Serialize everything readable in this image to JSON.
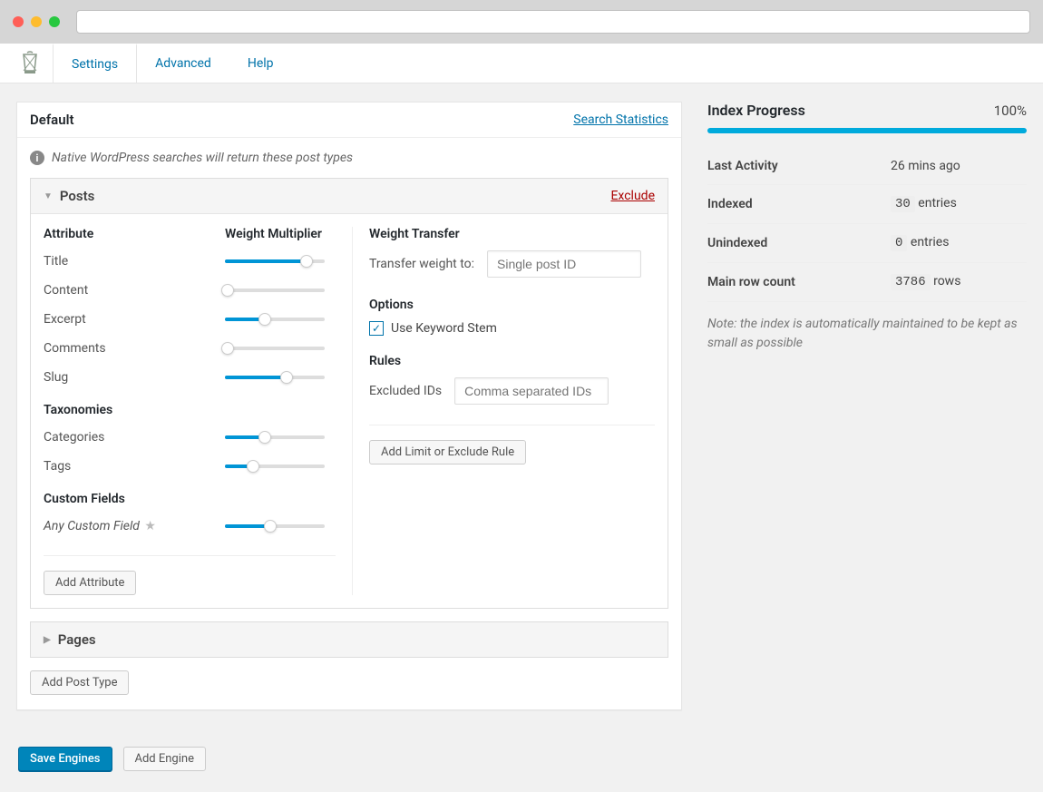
{
  "tabs": {
    "settings": "Settings",
    "advanced": "Advanced",
    "help": "Help"
  },
  "panel": {
    "title": "Default",
    "stats_link": "Search Statistics",
    "note": "Native WordPress searches will return these post types"
  },
  "posts": {
    "title": "Posts",
    "exclude": "Exclude",
    "attribute_hdr": "Attribute",
    "weight_hdr": "Weight Multiplier",
    "attrs": {
      "title": {
        "label": "Title",
        "pct": 82
      },
      "content": {
        "label": "Content",
        "pct": 3
      },
      "excerpt": {
        "label": "Excerpt",
        "pct": 40
      },
      "comments": {
        "label": "Comments",
        "pct": 3
      },
      "slug": {
        "label": "Slug",
        "pct": 62
      }
    },
    "taxonomies_hdr": "Taxonomies",
    "tax": {
      "categories": {
        "label": "Categories",
        "pct": 40
      },
      "tags": {
        "label": "Tags",
        "pct": 28
      }
    },
    "custom_fields_hdr": "Custom Fields",
    "custom_field": {
      "label": "Any Custom Field",
      "pct": 45
    },
    "add_attr_btn": "Add Attribute",
    "transfer_hdr": "Weight Transfer",
    "transfer_label": "Transfer weight to:",
    "transfer_placeholder": "Single post ID",
    "options_hdr": "Options",
    "keyword_stem": "Use Keyword Stem",
    "rules_hdr": "Rules",
    "excluded_ids_label": "Excluded IDs",
    "excluded_ids_placeholder": "Comma separated IDs",
    "add_rule_btn": "Add Limit or Exclude Rule"
  },
  "pages": {
    "title": "Pages"
  },
  "buttons": {
    "add_post_type": "Add Post Type",
    "save_engines": "Save Engines",
    "add_engine": "Add Engine"
  },
  "sidebar": {
    "title": "Index Progress",
    "pct_text": "100%",
    "pct_value": 100,
    "last_activity_label": "Last Activity",
    "last_activity_val": "26 mins ago",
    "indexed_label": "Indexed",
    "indexed_val": "30",
    "indexed_unit": "entries",
    "unindexed_label": "Unindexed",
    "unindexed_val": "0",
    "unindexed_unit": "entries",
    "main_row_label": "Main row count",
    "main_row_val": "3786",
    "main_row_unit": "rows",
    "note": "Note: the index is automatically maintained to be kept as small as possible"
  }
}
